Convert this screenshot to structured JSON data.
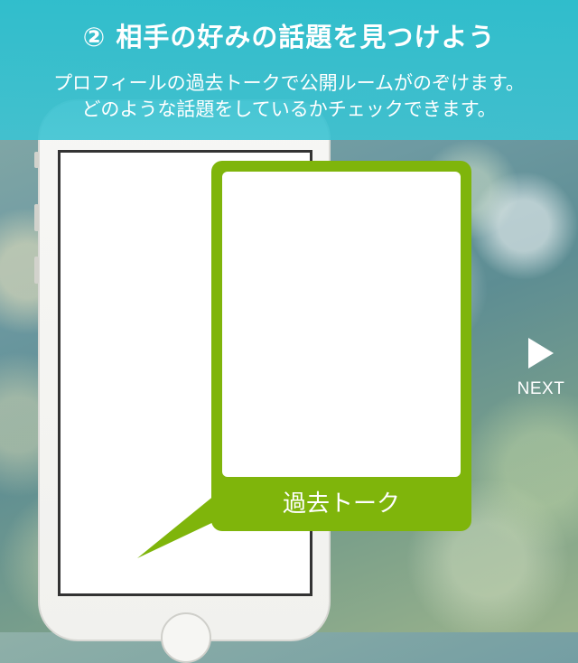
{
  "header": {
    "title": "② 相手の好みの話題を見つけよう",
    "subtitle_line1": "プロフィールの過去トークで公開ルームがのぞけます。",
    "subtitle_line2": "どのような話題をしているかチェックできます。"
  },
  "callout": {
    "label": "過去トーク"
  },
  "navigation": {
    "next_label": "NEXT",
    "next_icon": "play-arrow-icon"
  },
  "colors": {
    "header_bg": "#2dbecd",
    "accent_green": "#7fb50b",
    "text_white": "#ffffff"
  }
}
